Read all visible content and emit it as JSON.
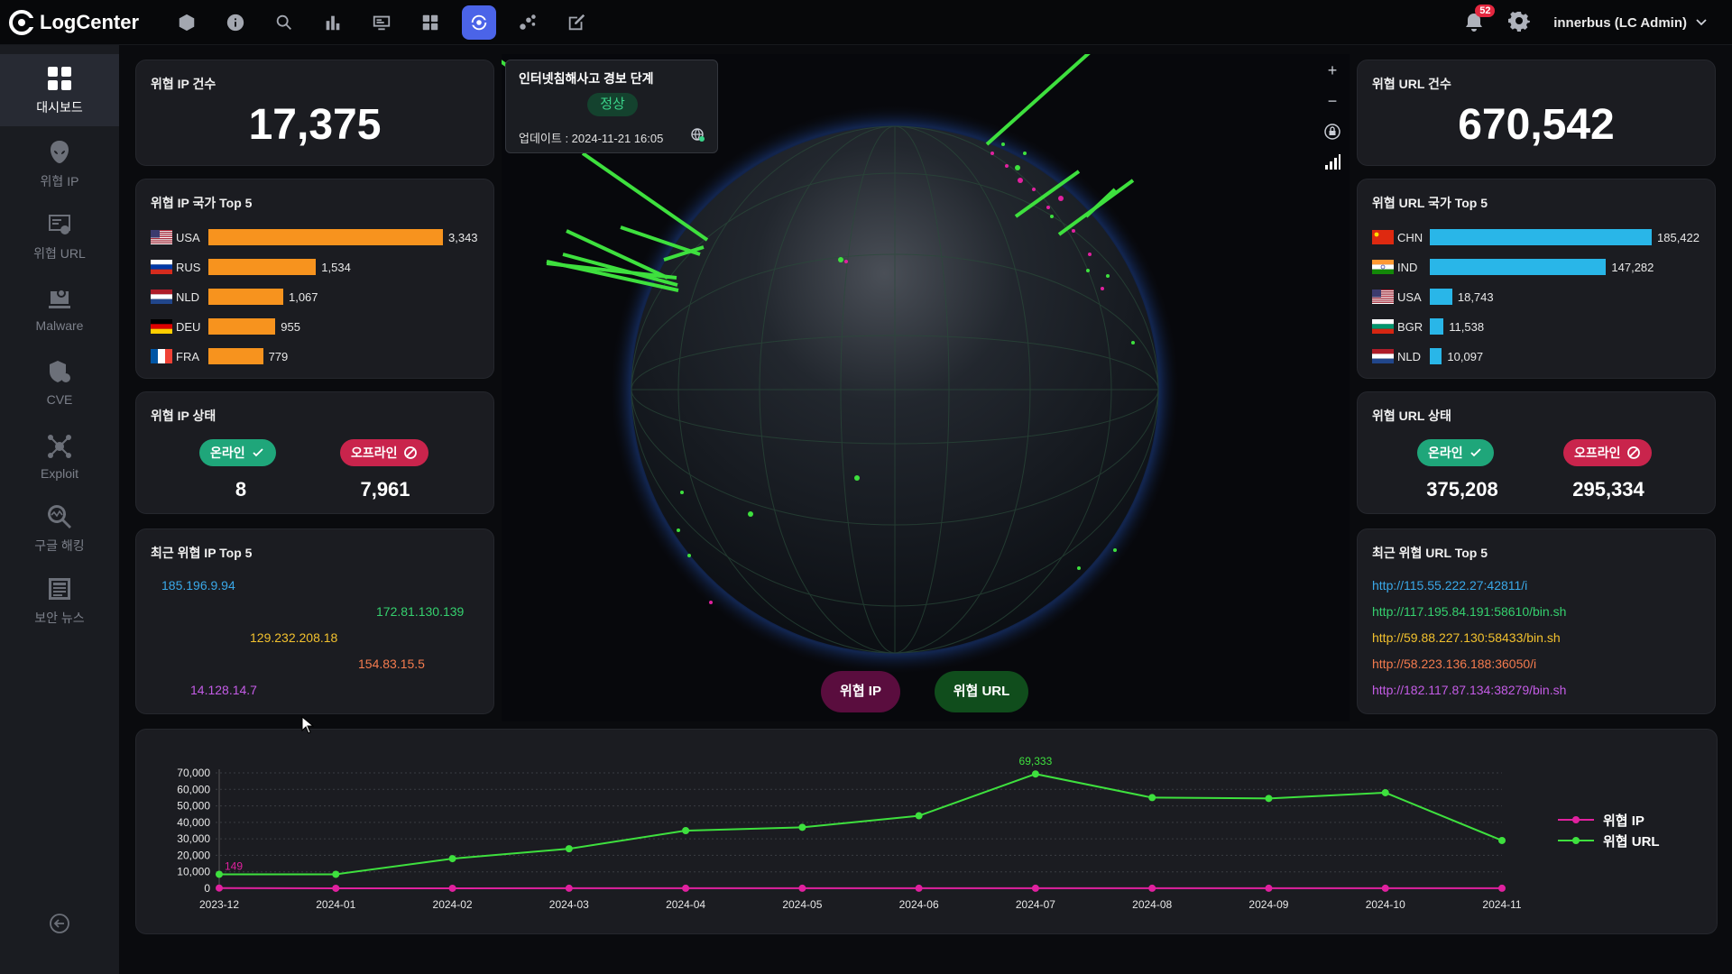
{
  "app": {
    "name": "LogCenter"
  },
  "header": {
    "icons": [
      "cube-icon",
      "info-icon",
      "search-icon",
      "bar-chart-icon",
      "monitor-icon",
      "grid-icon",
      "dashboard-sync-icon",
      "nodes-icon",
      "edit-icon"
    ],
    "active_icon": "dashboard-sync-icon",
    "notification_count": "52",
    "user": "innerbus (LC Admin)"
  },
  "sidebar": {
    "items": [
      {
        "label": "대시보드",
        "icon": "dashboard-icon",
        "active": true
      },
      {
        "label": "위협 IP",
        "icon": "alien-icon",
        "active": false
      },
      {
        "label": "위협 URL",
        "icon": "url-icon",
        "active": false
      },
      {
        "label": "Malware",
        "icon": "malware-icon",
        "active": false
      },
      {
        "label": "CVE",
        "icon": "cve-icon",
        "active": false
      },
      {
        "label": "Exploit",
        "icon": "exploit-icon",
        "active": false
      },
      {
        "label": "구글 해킹",
        "icon": "google-hack-icon",
        "active": false
      },
      {
        "label": "보안 뉴스",
        "icon": "news-icon",
        "active": false
      }
    ]
  },
  "left": {
    "ip_count": {
      "title": "위협 IP 건수",
      "value": "17,375"
    },
    "ip_country": {
      "title": "위협 IP 국가 Top 5",
      "color": "#f7931e",
      "rows": [
        {
          "code": "USA",
          "value": 3343,
          "label": "3,343"
        },
        {
          "code": "RUS",
          "value": 1534,
          "label": "1,534"
        },
        {
          "code": "NLD",
          "value": 1067,
          "label": "1,067"
        },
        {
          "code": "DEU",
          "value": 955,
          "label": "955"
        },
        {
          "code": "FRA",
          "value": 779,
          "label": "779"
        }
      ]
    },
    "ip_status": {
      "title": "위협 IP 상태",
      "online_label": "온라인",
      "offline_label": "오프라인",
      "online": "8",
      "offline": "7,961"
    },
    "recent_ip": {
      "title": "최근 위협 IP Top 5",
      "items": [
        {
          "text": "185.196.9.94",
          "color": "#3aa8e8"
        },
        {
          "text": "172.81.130.139",
          "color": "#35d06e"
        },
        {
          "text": "129.232.208.18",
          "color": "#f2c12e"
        },
        {
          "text": "154.83.15.5",
          "color": "#f47b4e"
        },
        {
          "text": "14.128.14.7",
          "color": "#c45ce6"
        }
      ]
    }
  },
  "right": {
    "url_count": {
      "title": "위협 URL 건수",
      "value": "670,542"
    },
    "url_country": {
      "title": "위협 URL 국가 Top 5",
      "color": "#29b6e8",
      "rows": [
        {
          "code": "CHN",
          "value": 185422,
          "label": "185,422"
        },
        {
          "code": "IND",
          "value": 147282,
          "label": "147,282"
        },
        {
          "code": "USA",
          "value": 18743,
          "label": "18,743"
        },
        {
          "code": "BGR",
          "value": 11538,
          "label": "11,538"
        },
        {
          "code": "NLD",
          "value": 10097,
          "label": "10,097"
        }
      ]
    },
    "url_status": {
      "title": "위협 URL 상태",
      "online_label": "온라인",
      "offline_label": "오프라인",
      "online": "375,208",
      "offline": "295,334"
    },
    "recent_url": {
      "title": "최근 위협 URL Top 5",
      "items": [
        {
          "text": "http://115.55.222.27:42811/i",
          "color": "#3aa8e8"
        },
        {
          "text": "http://117.195.84.191:58610/bin.sh",
          "color": "#35d06e"
        },
        {
          "text": "http://59.88.227.130:58433/bin.sh",
          "color": "#f2c12e"
        },
        {
          "text": "http://58.223.136.188:36050/i",
          "color": "#f47b4e"
        },
        {
          "text": "http://182.117.87.134:38279/bin.sh",
          "color": "#c45ce6"
        }
      ]
    }
  },
  "globe": {
    "alert_title": "인터넷침해사고 경보 단계",
    "alert_status": "정상",
    "alert_update": "업데이트 : 2024-11-21 16:05",
    "btn_ip": "위협 IP",
    "btn_url": "위협 URL",
    "controls": [
      "zoom-in-icon",
      "zoom-out-icon",
      "lock-rotate-icon",
      "signal-bars-icon"
    ]
  },
  "chart_data": {
    "type": "line",
    "x": [
      "2023-12",
      "2024-01",
      "2024-02",
      "2024-03",
      "2024-04",
      "2024-05",
      "2024-06",
      "2024-07",
      "2024-08",
      "2024-09",
      "2024-10",
      "2024-11"
    ],
    "ylim": [
      0,
      70000
    ],
    "yticks": [
      "70,000",
      "60,000",
      "50,000",
      "40,000",
      "30,000",
      "20,000",
      "10,000",
      "0"
    ],
    "series": [
      {
        "name": "위협 IP",
        "color": "#e0219f",
        "values": [
          149,
          30,
          30,
          40,
          40,
          40,
          40,
          40,
          40,
          40,
          40,
          40
        ]
      },
      {
        "name": "위협 URL",
        "color": "#3ee03e",
        "values": [
          8500,
          8500,
          18000,
          24000,
          35000,
          37000,
          44000,
          69333,
          55000,
          54500,
          58000,
          29000
        ]
      }
    ],
    "annotations": [
      {
        "series": "위협 URL",
        "index": 7,
        "text": "69,333"
      },
      {
        "series": "위협 IP",
        "index": 0,
        "text": "149"
      }
    ],
    "grid": true,
    "legend": "right"
  }
}
